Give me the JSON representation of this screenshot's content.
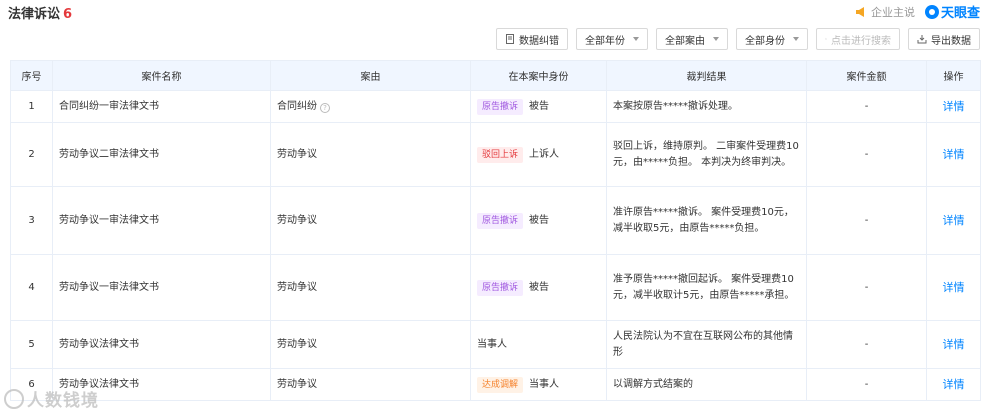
{
  "header": {
    "title": "法律诉讼",
    "count": "6",
    "owner_label": "企业主说",
    "brand": "天眼查"
  },
  "toolbar": {
    "data_error": "数据纠错",
    "all_years": "全部年份",
    "all_causes": "全部案由",
    "all_roles": "全部身份",
    "search_placeholder": "点击进行搜索",
    "export": "导出数据"
  },
  "table": {
    "columns": [
      "序号",
      "案件名称",
      "案由",
      "在本案中身份",
      "裁判结果",
      "案件金额",
      "操作"
    ],
    "rows": [
      {
        "no": "1",
        "name": "合同纠纷一审法律文书",
        "cause": "合同纠纷",
        "tag": "原告撤诉",
        "role": "被告",
        "result": "本案按原告*****撤诉处理。",
        "amount": "-",
        "action": "详情"
      },
      {
        "no": "2",
        "name": "劳动争议二审法律文书",
        "cause": "劳动争议",
        "tag": "驳回上诉",
        "role": "上诉人",
        "result": "驳回上诉，维持原判。 二审案件受理费10元，由*****负担。 本判决为终审判决。",
        "amount": "-",
        "action": "详情"
      },
      {
        "no": "3",
        "name": "劳动争议一审法律文书",
        "cause": "劳动争议",
        "tag": "原告撤诉",
        "role": "被告",
        "result": "准许原告*****撤诉。 案件受理费10元，减半收取5元，由原告*****负担。",
        "amount": "-",
        "action": "详情"
      },
      {
        "no": "4",
        "name": "劳动争议一审法律文书",
        "cause": "劳动争议",
        "tag": "原告撤诉",
        "role": "被告",
        "result": "准予原告*****撤回起诉。 案件受理费10元，减半收取计5元，由原告*****承担。",
        "amount": "-",
        "action": "详情"
      },
      {
        "no": "5",
        "name": "劳动争议法律文书",
        "cause": "劳动争议",
        "tag": "",
        "role": "当事人",
        "result": "人民法院认为不宜在互联网公布的其他情形",
        "amount": "-",
        "action": "详情"
      },
      {
        "no": "6",
        "name": "劳动争议法律文书",
        "cause": "劳动争议",
        "tag": "达成调解",
        "role": "当事人",
        "result": "以调解方式结案的",
        "amount": "-",
        "action": "详情"
      }
    ]
  },
  "watermark": "人数钱境",
  "colors": {
    "accent": "#0084ff",
    "count_red": "#e4393c",
    "header_bg": "#f0f6ff"
  }
}
